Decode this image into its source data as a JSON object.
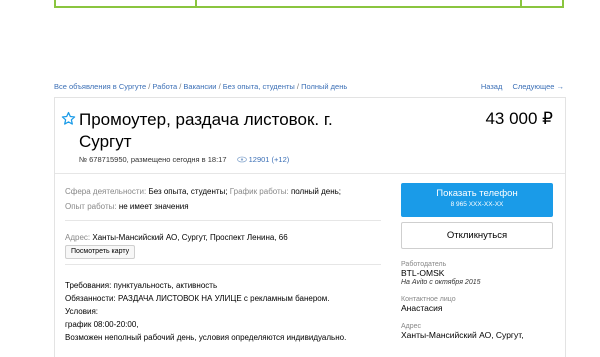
{
  "breadcrumbs": [
    "Все объявления в Сургуте",
    "Работа",
    "Вакансии",
    "Без опыта, студенты",
    "Полный день"
  ],
  "nav": {
    "back": "Назад",
    "next": "Следующее →"
  },
  "listing": {
    "title": "Промоутер, раздача листовок. г. Сургут",
    "price": "43 000 ₽",
    "number_posted": "№ 678715950, размещено сегодня в 18:17",
    "views": "12901 (+12)"
  },
  "params": {
    "sphere_label": "Сфера деятельности:",
    "sphere_value": "Без опыта, студенты;",
    "schedule_label": "График работы:",
    "schedule_value": "полный день;",
    "experience_label": "Опыт работы:",
    "experience_value": "не имеет значения"
  },
  "address": {
    "label": "Адрес:",
    "value": "Ханты-Мансийский АО, Сургут, Проспект Ленина, 66",
    "map_button": "Посмотреть карту"
  },
  "description": [
    "Требования: пунктуальность, активность",
    "Обязанности: РАЗДАЧА ЛИСТОВОК НА УЛИЦЕ с рекламным банером.",
    "Условия:",
    "график 08:00-20:00,",
    "Возможен неполный рабочий день, условия определяются индивидуально."
  ],
  "sidebar": {
    "phone_button": "Показать телефон",
    "phone_number": "8 965 XXX-XX-XX",
    "respond_button": "Откликнуться",
    "seller_label": "Работодатель",
    "seller_name": "BTL-OMSK",
    "seller_since": "На Avito с октября 2015",
    "contact_label": "Контактное лицо",
    "contact_name": "Анастасия",
    "address_label": "Адрес",
    "address_value": "Ханты-Мансийский АО, Сургут,"
  },
  "colors": {
    "accent": "#1a9be8",
    "link": "#3b6fb6",
    "top_border": "#8ac53f"
  }
}
